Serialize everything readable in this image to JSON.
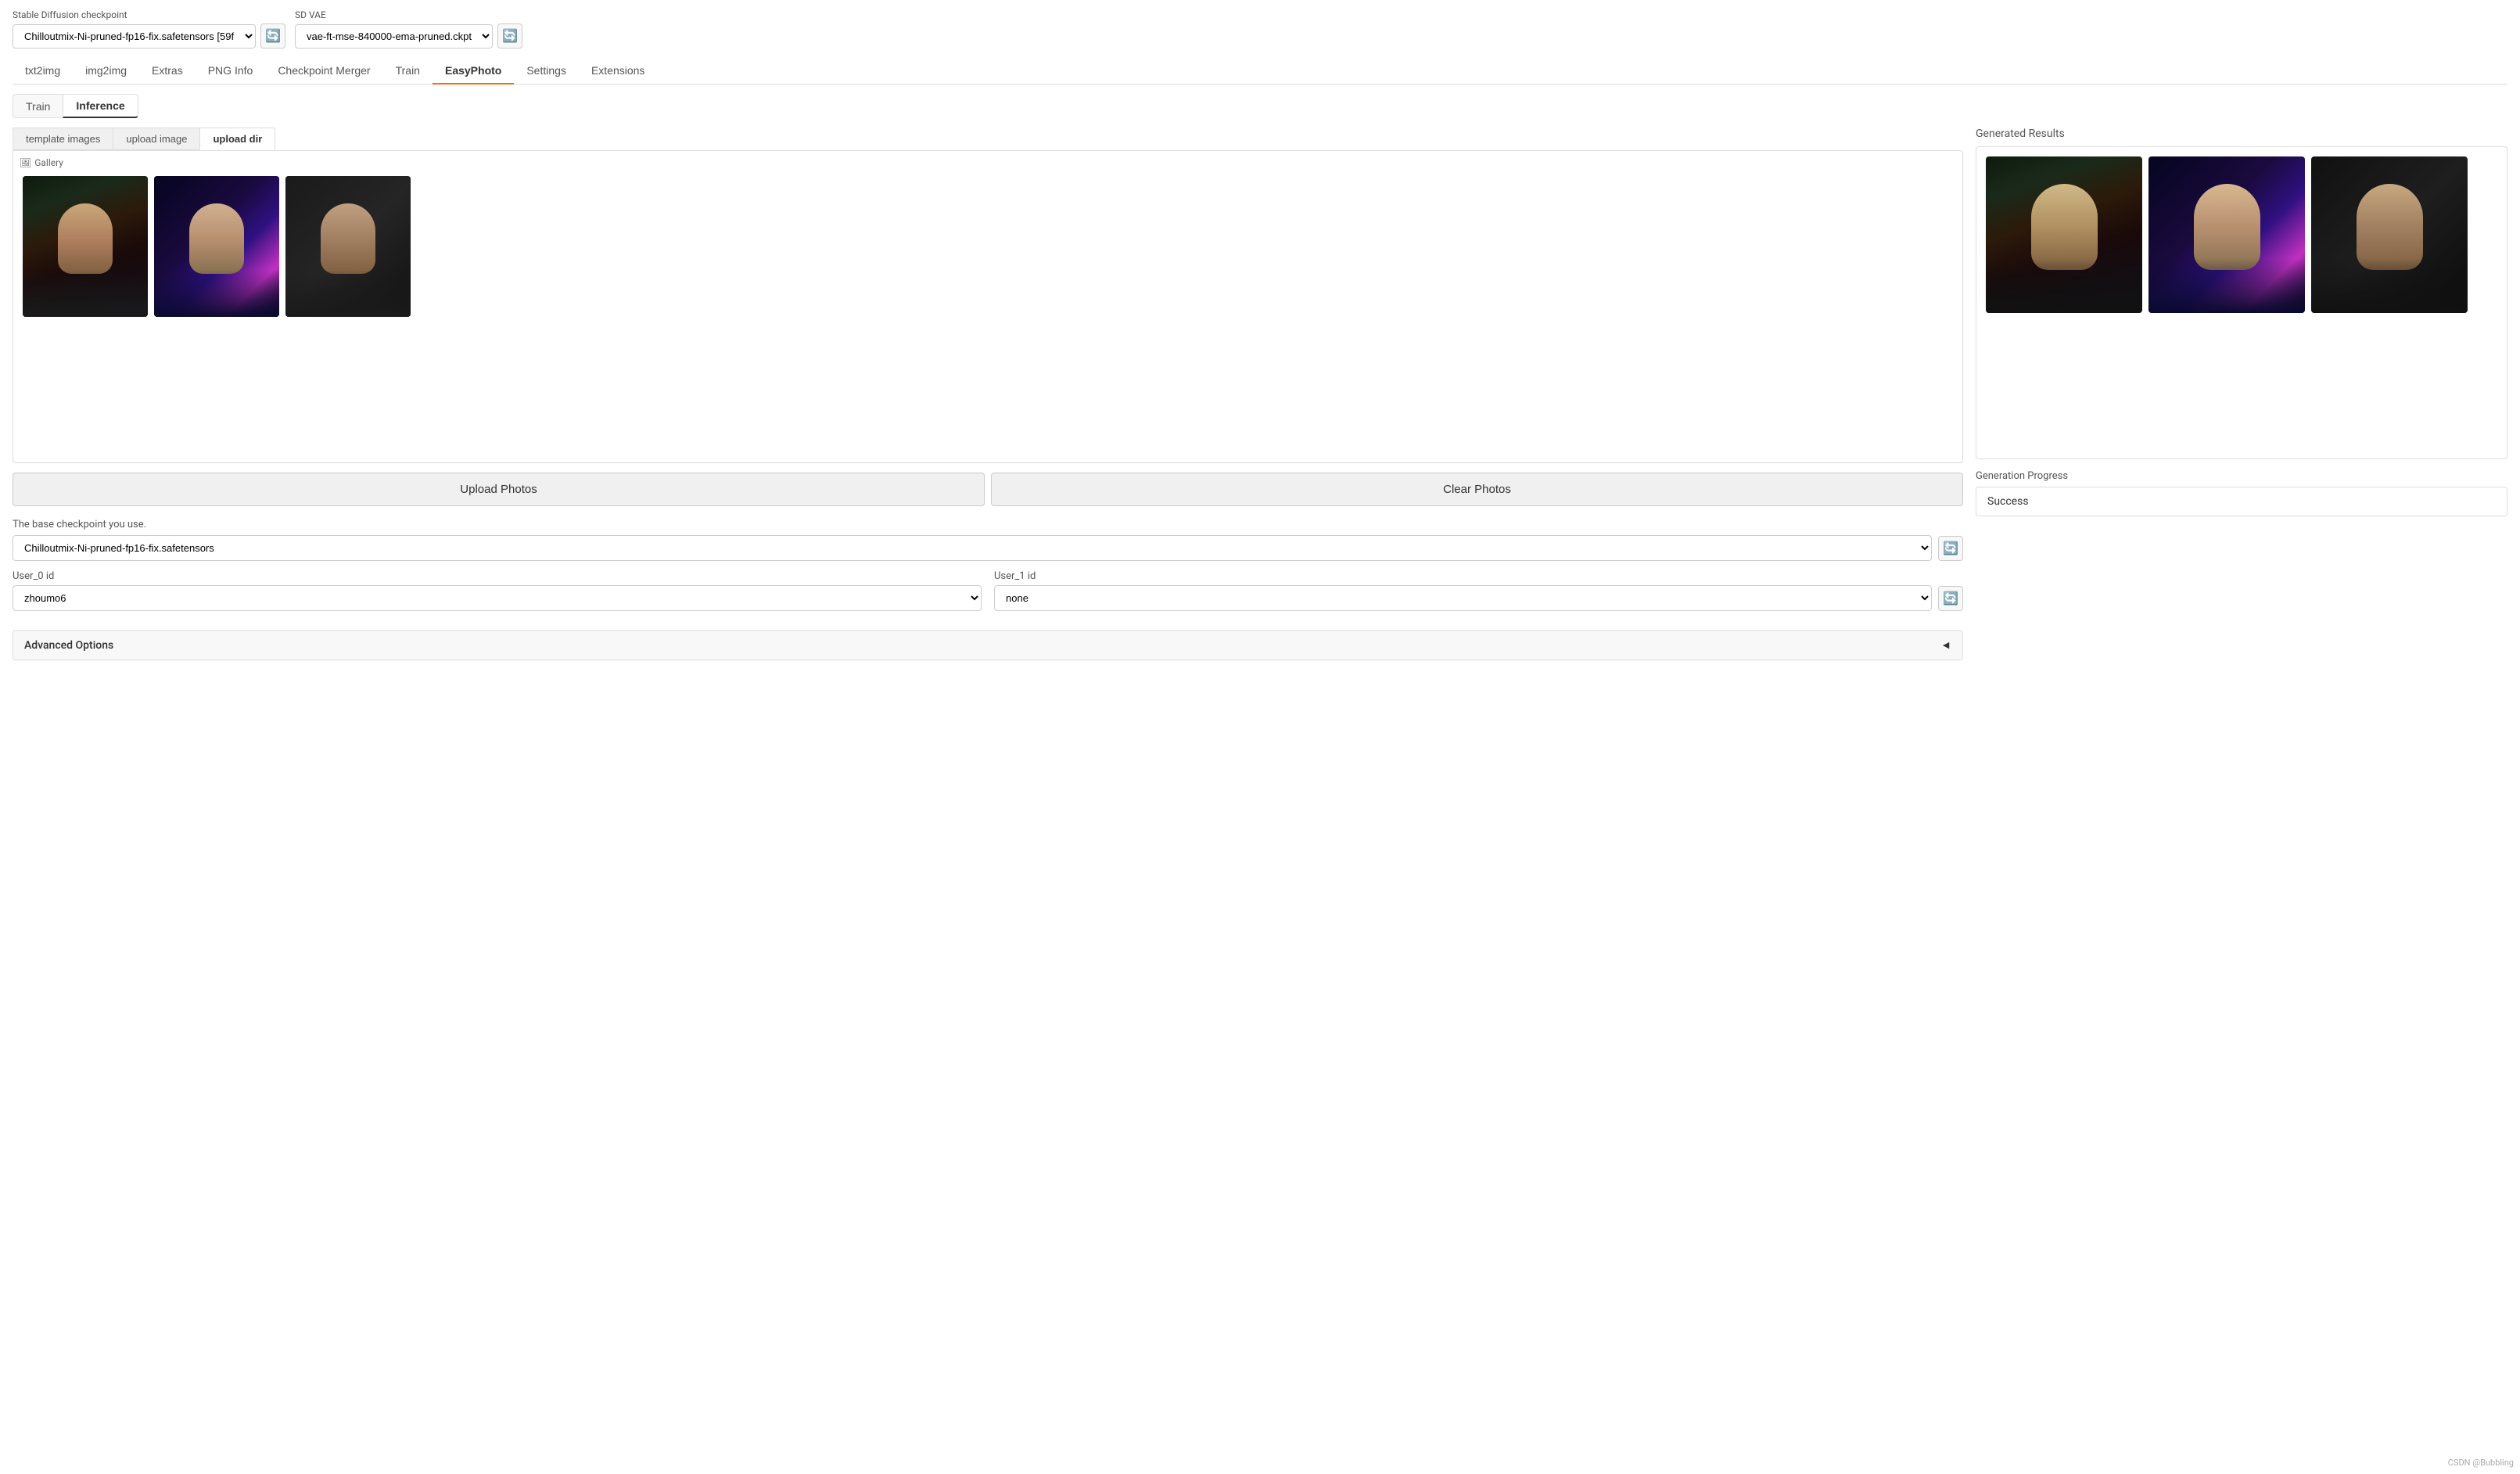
{
  "header": {
    "checkpoint_label": "Stable Diffusion checkpoint",
    "vae_label": "SD VAE",
    "checkpoint_value": "Chilloutmix-Ni-pruned-fp16-fix.safetensors [59f",
    "vae_value": "vae-ft-mse-840000-ema-pruned.ckpt"
  },
  "main_nav": {
    "items": [
      {
        "label": "txt2img",
        "active": false
      },
      {
        "label": "img2img",
        "active": false
      },
      {
        "label": "Extras",
        "active": false
      },
      {
        "label": "PNG Info",
        "active": false
      },
      {
        "label": "Checkpoint Merger",
        "active": false
      },
      {
        "label": "Train",
        "active": false
      },
      {
        "label": "EasyPhoto",
        "active": true
      },
      {
        "label": "Settings",
        "active": false
      },
      {
        "label": "Extensions",
        "active": false
      }
    ]
  },
  "sub_tabs": {
    "items": [
      {
        "label": "Train",
        "active": false
      },
      {
        "label": "Inference",
        "active": true
      }
    ]
  },
  "upload_tabs": {
    "items": [
      {
        "label": "template images",
        "active": false
      },
      {
        "label": "upload image",
        "active": false
      },
      {
        "label": "upload dir",
        "active": true
      }
    ]
  },
  "gallery": {
    "label": "Gallery",
    "images": [
      {
        "id": "img1",
        "style": "1"
      },
      {
        "id": "img2",
        "style": "2"
      },
      {
        "id": "img3",
        "style": "3"
      }
    ]
  },
  "buttons": {
    "upload_photos": "Upload Photos",
    "clear_photos": "Clear Photos"
  },
  "config": {
    "checkpoint_label": "The base checkpoint you use.",
    "checkpoint_value": "Chilloutmix-Ni-pruned-fp16-fix.safetensors",
    "user0_label": "User_0 id",
    "user0_value": "zhoumo6",
    "user1_label": "User_1 id",
    "user1_value": "none",
    "user_options": [
      "none",
      "zhoumo6"
    ],
    "advanced_label": "Advanced Options"
  },
  "right_panel": {
    "results_label": "Generated Results",
    "results_images": [
      {
        "id": "res1",
        "style": "1"
      },
      {
        "id": "res2",
        "style": "2"
      },
      {
        "id": "res3",
        "style": "3"
      }
    ],
    "progress_label": "Generation Progress",
    "progress_status": "Success"
  },
  "icons": {
    "refresh": "🔄",
    "gallery": "🖼",
    "chevron_left": "◄"
  },
  "watermark": "CSDN @Bubbling"
}
